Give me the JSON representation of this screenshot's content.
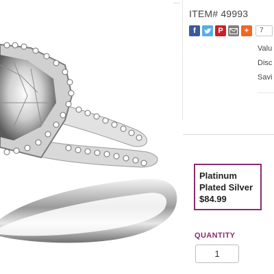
{
  "product": {
    "item_number": "ITEM# 49993",
    "image_alt": "ring-photo"
  },
  "share": {
    "buttons": [
      {
        "name": "facebook",
        "glyph": "f",
        "color": "#3b5998"
      },
      {
        "name": "twitter",
        "glyph": "t",
        "color": "#55acee"
      },
      {
        "name": "pinterest",
        "glyph": "P",
        "color": "#cb2027"
      },
      {
        "name": "email",
        "glyph": "✉",
        "color": "#7f7f7f"
      },
      {
        "name": "more",
        "glyph": "+",
        "color": "#f26522"
      }
    ],
    "count": "7"
  },
  "pricing": {
    "value_label": "Valu",
    "discount_label": "Disc",
    "savings_label": "Savi"
  },
  "option": {
    "line1": "Platinum",
    "line2": "Plated Silver",
    "price": "$84.99",
    "accent_color": "#8a2b6f"
  },
  "quantity": {
    "label": "QUANTITY",
    "value": "1"
  }
}
